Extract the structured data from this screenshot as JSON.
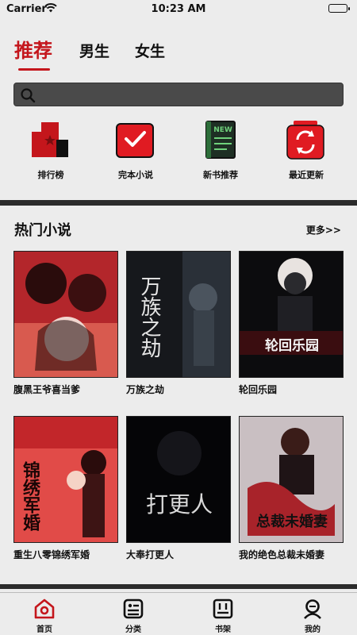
{
  "status_bar": {
    "carrier": "Carrier",
    "time": "10:23 AM"
  },
  "tabs": [
    {
      "label": "推荐",
      "active": true
    },
    {
      "label": "男生",
      "active": false
    },
    {
      "label": "女生",
      "active": false
    }
  ],
  "search": {
    "placeholder": "",
    "value": ""
  },
  "quick_nav": [
    {
      "label": "排行榜",
      "icon": "ranking-icon"
    },
    {
      "label": "完本小说",
      "icon": "finished-check-icon"
    },
    {
      "label": "新书推荐",
      "icon": "new-book-icon"
    },
    {
      "label": "最近更新",
      "icon": "refresh-icon"
    }
  ],
  "hot_section": {
    "title": "热门小说",
    "more": "更多>>"
  },
  "books": [
    {
      "title": "腹黑王爷喜当爹",
      "cover_text": ""
    },
    {
      "title": "万族之劫",
      "cover_text": "万族之劫"
    },
    {
      "title": "轮回乐园",
      "cover_text": "轮回乐园"
    },
    {
      "title": "重生八零锦绣军婚",
      "cover_text": "锦绣军婚"
    },
    {
      "title": "大奉打更人",
      "cover_text": "打更人"
    },
    {
      "title": "我的绝色总裁未婚妻",
      "cover_text": "总裁未婚妻"
    }
  ],
  "bottom_nav": [
    {
      "label": "首页",
      "icon": "home-icon",
      "active": true
    },
    {
      "label": "分类",
      "icon": "category-icon",
      "active": false
    },
    {
      "label": "书架",
      "icon": "bookshelf-icon",
      "active": false
    },
    {
      "label": "我的",
      "icon": "profile-icon",
      "active": false
    }
  ],
  "colors": {
    "accent": "#c4161c",
    "background": "#ececec",
    "search_bg": "#4a4a4a"
  }
}
